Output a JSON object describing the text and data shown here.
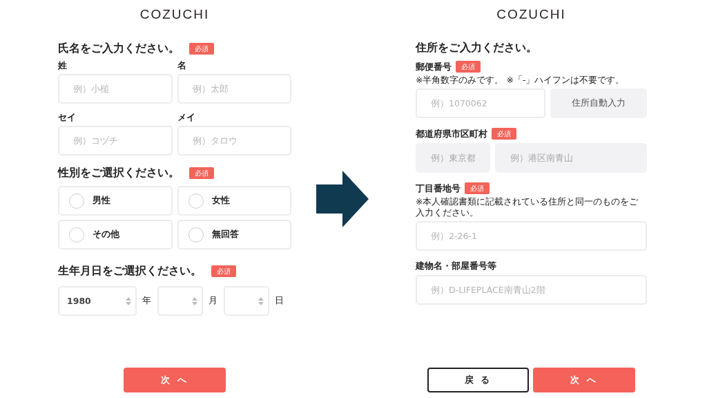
{
  "left_page": {
    "logo": "COZUCHI",
    "name_section": {
      "heading": "氏名をご入力ください。",
      "badge": "必須",
      "fields": [
        {
          "label": "姓",
          "placeholder": "例）小槌"
        },
        {
          "label": "名",
          "placeholder": "例）太郎"
        },
        {
          "label": "セイ",
          "placeholder": "例）コヅチ"
        },
        {
          "label": "メイ",
          "placeholder": "例）タロウ"
        }
      ]
    },
    "gender_section": {
      "heading": "性別をご選択ください。",
      "badge": "必須",
      "options": [
        {
          "label": "男性",
          "selected": false
        },
        {
          "label": "女性",
          "selected": false
        },
        {
          "label": "その他",
          "selected": false
        },
        {
          "label": "無回答",
          "selected": false
        }
      ]
    },
    "birth_section": {
      "heading": "生年月日をご選択ください。",
      "badge": "必須",
      "selects": [
        {
          "value": "1980",
          "unit": "年"
        },
        {
          "unit": "月"
        },
        {
          "unit": "日"
        }
      ]
    },
    "next_button": "次 へ"
  },
  "right_page": {
    "logo": "COZUCHI",
    "heading": "住所をご入力ください。",
    "groups": [
      {
        "kind": "zip",
        "label": "郵便番号",
        "badge": "必須",
        "note": "※半角数字のみです。 ※「-」ハイフンは不要です。",
        "fields": [
          {
            "placeholder": "例）1070062",
            "disabled": false
          }
        ],
        "button": "住所自動入力"
      },
      {
        "kind": "pair",
        "label": "都道府県市区町村",
        "badge": "必須",
        "fields": [
          {
            "placeholder": "例）東京都",
            "disabled": true
          },
          {
            "placeholder": "例）港区南青山",
            "disabled": true
          }
        ]
      },
      {
        "kind": "single",
        "label": "丁目番地号",
        "badge": "必須",
        "note": "※本人確認書類に記載されている住所と同一のものをご入力ください。",
        "fields": [
          {
            "placeholder": "例）2-26-1",
            "disabled": false
          }
        ]
      },
      {
        "kind": "single",
        "label": "建物名・部屋番号等",
        "fields": [
          {
            "placeholder": "例）D-LIFEPLACE南青山2階",
            "disabled": false
          }
        ]
      }
    ],
    "back_button": "戻 る",
    "next_button": "次 へ"
  }
}
